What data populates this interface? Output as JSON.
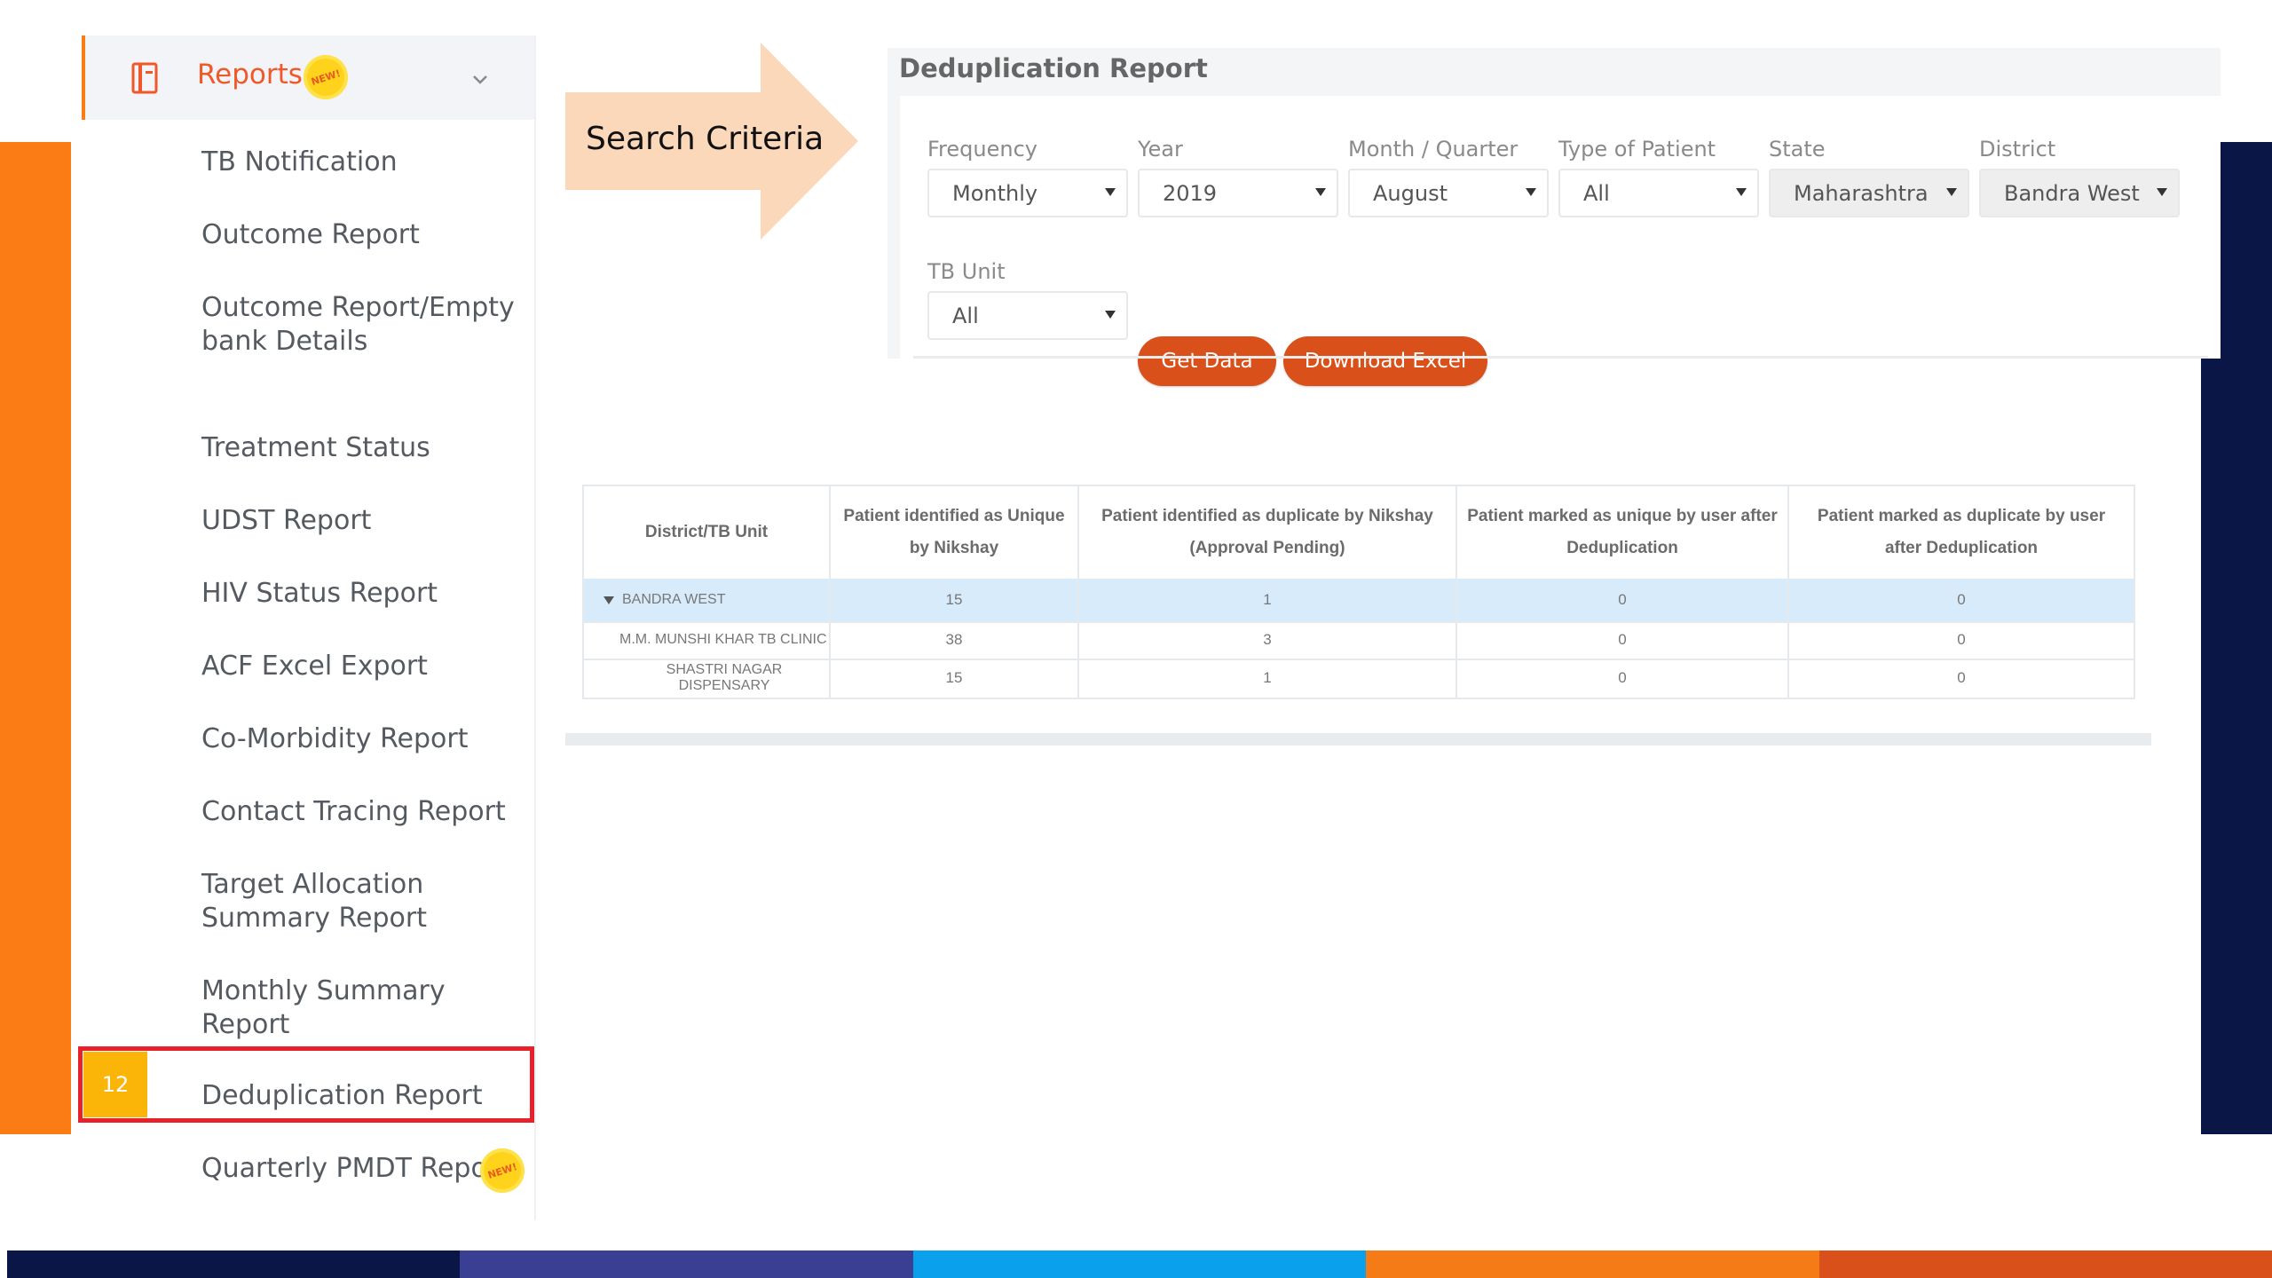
{
  "sidebar": {
    "section_label": "Reports",
    "new_badge": "NEW!",
    "items": [
      {
        "label": "TB Notification"
      },
      {
        "label": "Outcome Report"
      },
      {
        "label": "Outcome Report/Empty bank Details"
      },
      {
        "label": "Treatment Status"
      },
      {
        "label": "UDST Report"
      },
      {
        "label": "HIV Status Report"
      },
      {
        "label": "ACF Excel Export"
      },
      {
        "label": "Co-Morbidity Report"
      },
      {
        "label": "Contact Tracing Report"
      },
      {
        "label": "Target Allocation Summary Report"
      },
      {
        "label": "Monthly Summary Report"
      },
      {
        "label": "Deduplication Report"
      },
      {
        "label": "Quarterly PMDT Report"
      }
    ],
    "step_number": "12"
  },
  "callout": {
    "label": "Search Criteria"
  },
  "report": {
    "title": "Deduplication Report",
    "filters": {
      "frequency": {
        "label": "Frequency",
        "value": "Monthly"
      },
      "year": {
        "label": "Year",
        "value": "2019"
      },
      "month": {
        "label": "Month / Quarter",
        "value": "August"
      },
      "patient_type": {
        "label": "Type of Patient",
        "value": "All"
      },
      "state": {
        "label": "State",
        "value": "Maharashtra"
      },
      "district": {
        "label": "District",
        "value": "Bandra West"
      },
      "tb_unit": {
        "label": "TB Unit",
        "value": "All"
      }
    },
    "buttons": {
      "get_data": "Get Data",
      "download": "Download Excel"
    }
  },
  "table": {
    "headers": [
      "District/TB Unit",
      "Patient identified as Unique by Nikshay",
      "Patient identified as duplicate by Nikshay (Approval Pending)",
      "Patient marked as unique by user after Deduplication",
      "Patient marked as duplicate by user after Deduplication"
    ],
    "rows": [
      [
        "BANDRA WEST",
        "15",
        "1",
        "0",
        "0"
      ],
      [
        "M.M. MUNSHI KHAR TB CLINIC",
        "38",
        "3",
        "0",
        "0"
      ],
      [
        "SHASTRI NAGAR DISPENSARY",
        "15",
        "1",
        "0",
        "0"
      ]
    ]
  },
  "colors": {
    "accent_orange": "#fb7b14",
    "navy": "#0a1646",
    "button": "#d9501a",
    "highlight_red": "#e8202a",
    "selected_row": "#d8ebfb",
    "bottom_strip": [
      "#0a1646",
      "#3b3f94",
      "#0aa0ec",
      "#f57b16",
      "#d9501a"
    ]
  }
}
